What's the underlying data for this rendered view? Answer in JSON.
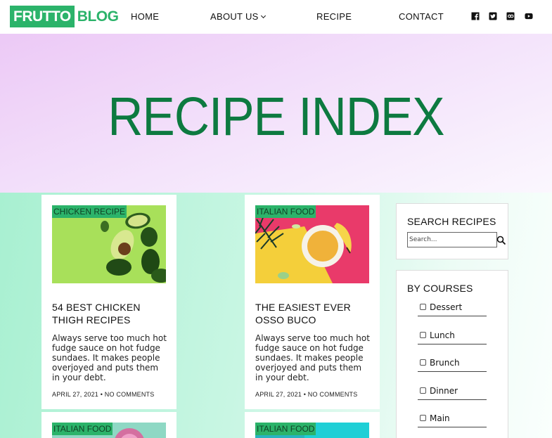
{
  "brand": {
    "logo_box": "FRUTTO",
    "logo_text": "BLOG"
  },
  "nav": {
    "home": "HOME",
    "about": "ABOUT US",
    "recipe": "RECIPE",
    "contact": "CONTACT"
  },
  "social_icons": [
    "facebook-icon",
    "twitter-icon",
    "500px-icon",
    "youtube-icon"
  ],
  "hero": {
    "title": "RECIPE INDEX"
  },
  "cards": [
    {
      "tag": "CHICKEN RECIPE",
      "title": "54 BEST CHICKEN THIGH RECIPES",
      "excerpt": "Always serve too much hot fudge sauce on hot fudge sundaes. It makes people overjoyed and puts them in your debt.",
      "meta": "APRIL 27, 2021 • NO COMMENTS"
    },
    {
      "tag": "ITALIAN FOOD",
      "title": "THE EASIEST EVER OSSO BUCO",
      "excerpt": "Always serve too much hot fudge sauce on hot fudge sundaes. It makes people overjoyed and puts them in your debt.",
      "meta": "APRIL 27, 2021 • NO COMMENTS"
    },
    {
      "tag": "ITALIAN FOOD"
    },
    {
      "tag": "ITALIAN FOOD"
    }
  ],
  "sidebar": {
    "search": {
      "title": "SEARCH RECIPES",
      "placeholder": "Search..."
    },
    "courses": {
      "title": "BY COURSES",
      "items": [
        "Dessert",
        "Lunch",
        "Brunch",
        "Dinner",
        "Main"
      ]
    }
  },
  "colors": {
    "brand_green": "#2bb36a",
    "title_green": "#0d7a40",
    "hero_bg": "#ecc9f6",
    "content_bg": "#a8f0d1"
  }
}
